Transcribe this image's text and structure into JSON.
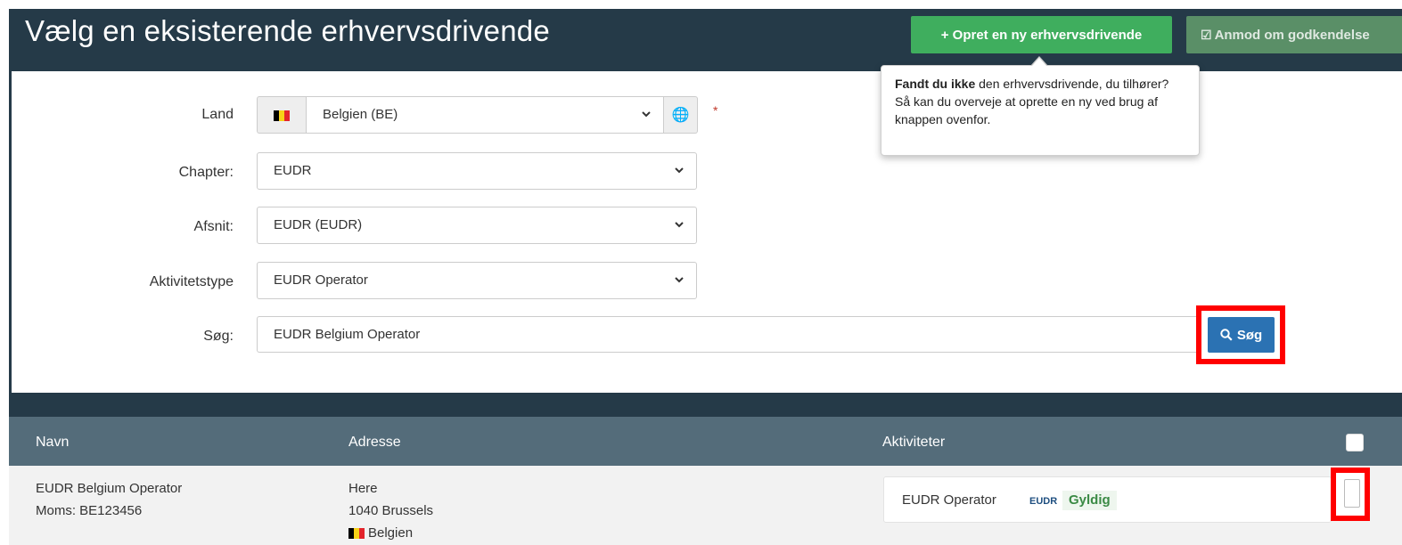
{
  "header": {
    "title": "Vælg en eksisterende erhvervsdrivende",
    "create_button": "+ Opret en ny erhvervsdrivende",
    "approve_button": "Anmod om godkendelse"
  },
  "tooltip": {
    "bold": "Fandt du ikke",
    "rest": " den erhvervsdrivende, du tilhører? Så kan du overveje at oprette en ny ved brug af knappen ovenfor."
  },
  "form": {
    "land_label": "Land",
    "land_value": "Belgien (BE)",
    "required_mark": "*",
    "chapter_label": "Chapter:",
    "chapter_value": "EUDR",
    "afsnit_label": "Afsnit:",
    "afsnit_value": "EUDR (EUDR)",
    "aktivitetstype_label": "Aktivitetstype",
    "aktivitetstype_value": "EUDR Operator",
    "search_label": "Søg:",
    "search_value": "EUDR Belgium Operator",
    "search_button": "Søg"
  },
  "table": {
    "columns": [
      "Navn",
      "Adresse",
      "Aktiviteter"
    ],
    "rows": [
      {
        "name": "EUDR Belgium Operator",
        "vat": "Moms: BE123456",
        "address_line1": "Here",
        "address_line2": "1040 Brussels",
        "country": "Belgien",
        "activity": "EUDR Operator",
        "activity_code": "EUDR",
        "status": "Gyldig"
      }
    ]
  },
  "colors": {
    "header_bg": "#253a48",
    "create_green": "#3fae5e",
    "search_blue": "#2b72b3",
    "highlight_red": "#ff0000"
  }
}
